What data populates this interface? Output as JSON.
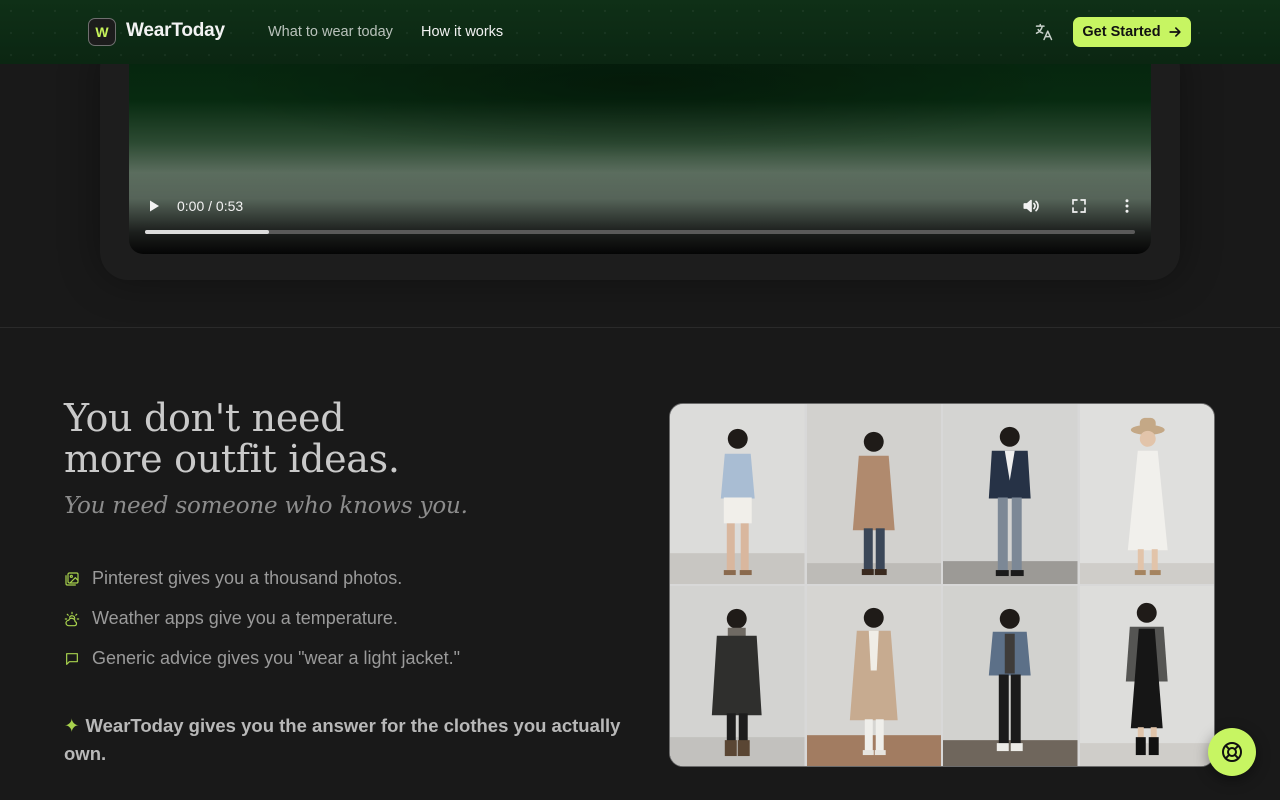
{
  "header": {
    "logo_letter": "W",
    "brand": "WearToday",
    "nav": [
      {
        "label": "What to wear today"
      },
      {
        "label": "How it works"
      }
    ],
    "cta_label": "Get Started"
  },
  "video": {
    "time_display": "0:00 / 0:53",
    "progress_fraction": 0.125
  },
  "intro": {
    "headline_line1": "You don't need",
    "headline_line2": "more outfit ideas.",
    "subhead": "You need someone who knows you.",
    "points": [
      {
        "icon": "image-gallery-icon",
        "text": "Pinterest gives you a thousand photos."
      },
      {
        "icon": "sun-cloud-icon",
        "text": "Weather apps give you a temperature."
      },
      {
        "icon": "chat-bubble-icon",
        "text": "Generic advice gives you \"wear a light jacket.\""
      }
    ],
    "answer_sparkle": "✦",
    "answer": "WearToday gives you the answer for the clothes you actually own."
  },
  "colors": {
    "accent": "#c7f562",
    "header_bg": "#0f3017",
    "page_bg": "#191919"
  }
}
